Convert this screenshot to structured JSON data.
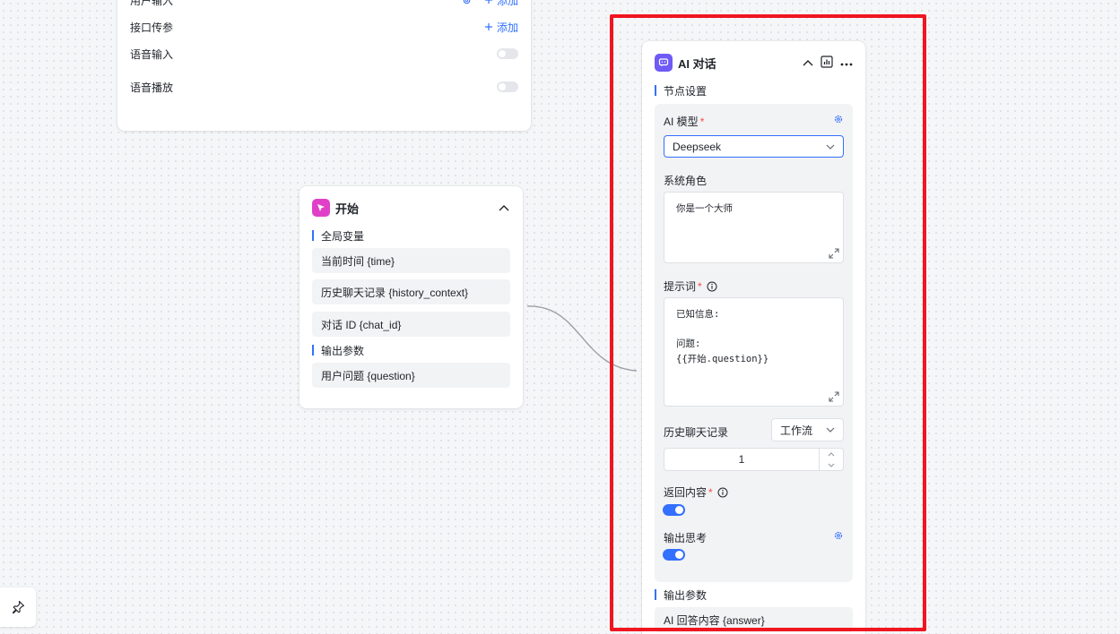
{
  "top_node": {
    "user_input_label": "用户输入",
    "user_input_add": "添加",
    "api_param_label": "接口传参",
    "api_param_add": "添加",
    "voice_input_label": "语音输入",
    "voice_input_enabled": false,
    "voice_play_label": "语音播放",
    "voice_play_enabled": false
  },
  "start_node": {
    "title": "开始",
    "global_vars_label": "全局变量",
    "global_vars": [
      "当前时间 {time}",
      "历史聊天记录 {history_context}",
      "对话 ID {chat_id}"
    ],
    "output_label": "输出参数",
    "outputs": [
      "用户问题 {question}"
    ]
  },
  "ai_node": {
    "title": "AI 对话",
    "node_settings_label": "节点设置",
    "model_label": "AI 模型",
    "model_value": "Deepseek",
    "system_role_label": "系统角色",
    "system_role_value": "你是一个大师",
    "prompt_label": "提示词",
    "prompt_value": "已知信息:\n\n问题:\n{{开始.question}}",
    "history_label": "历史聊天记录",
    "history_select": "工作流",
    "history_count": "1",
    "return_content_label": "返回内容",
    "return_content_enabled": true,
    "output_thinking_label": "输出思考",
    "output_thinking_enabled": true,
    "output_params_label": "输出参数",
    "outputs": [
      "AI 回答内容 {answer}"
    ]
  },
  "colors": {
    "accent": "#3370ff",
    "highlight": "#f0151f",
    "start_icon": "#e040c8",
    "ai_icon": "#6e5af5"
  }
}
